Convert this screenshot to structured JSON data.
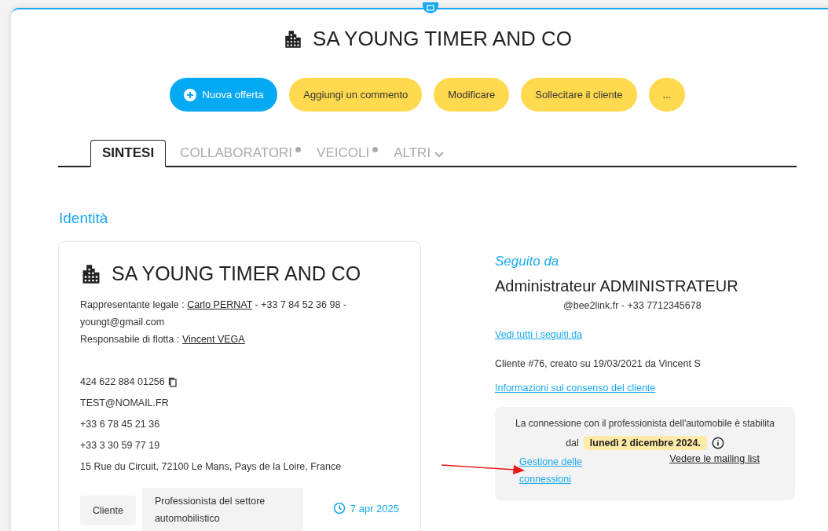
{
  "title": "SA YOUNG TIMER AND CO",
  "actions": [
    {
      "label": "Nuova offerta",
      "kind": "primary"
    },
    {
      "label": "Aggiungi un commento",
      "kind": "secondary"
    },
    {
      "label": "Modificare",
      "kind": "secondary"
    },
    {
      "label": "Sollecitare il cliente",
      "kind": "secondary"
    },
    {
      "label": "...",
      "kind": "secondary"
    }
  ],
  "tabs": [
    {
      "label": "SINTESI",
      "selected": true,
      "kind": "plain"
    },
    {
      "label": "COLLABORATORI",
      "selected": false,
      "kind": "badge"
    },
    {
      "label": "VEICOLI",
      "selected": false,
      "kind": "badge"
    },
    {
      "label": "ALTRI",
      "selected": false,
      "kind": "dropdown"
    }
  ],
  "section_title": "Identità",
  "card": {
    "title": "SA YOUNG TIMER AND CO",
    "legal_rep": {
      "label": "Rappresentante legale : ",
      "name": "Carlo PERNAT",
      "rest": " - +33 7 84 52 36 98 - youngt@gmail.com"
    },
    "fleet_manager": {
      "label": "Responsabile di flotta : ",
      "name": "Vincent VEGA"
    },
    "contacts": [
      {
        "text": "424 622 884 01256",
        "copy": true
      },
      {
        "text": "TEST@NOMAIL.FR",
        "copy": false
      },
      {
        "text": "+33 6 78 45 21 36",
        "copy": false
      },
      {
        "text": "+33 3 30 59 77 19",
        "copy": false
      },
      {
        "text": "15 Rue du Circuit, 72100 Le Mans, Pays de la Loire, France",
        "copy": false
      }
    ],
    "tags": [
      "Cliente",
      "Professionista del settore automobilistico"
    ],
    "date": "7 apr 2025"
  },
  "followed": {
    "heading": "Seguito da",
    "name": "Administrateur ADMINISTRATEUR",
    "contact": "@bee2link.fr - +33 7712345678",
    "all_link": "Vedi tutti i seguiti da",
    "created": "Cliente #76, creato su 19/03/2021 da Vincent S",
    "consent_link": "Informazioni sul consenso del cliente",
    "connection": {
      "text": "La connessione con il professionista dell'automobile è stabilita",
      "since": "dal",
      "date": "lunedì 2 dicembre 2024.",
      "manage_link": "Gestione delle connessioni",
      "mailing_link": "Vedere le mailing list"
    }
  }
}
